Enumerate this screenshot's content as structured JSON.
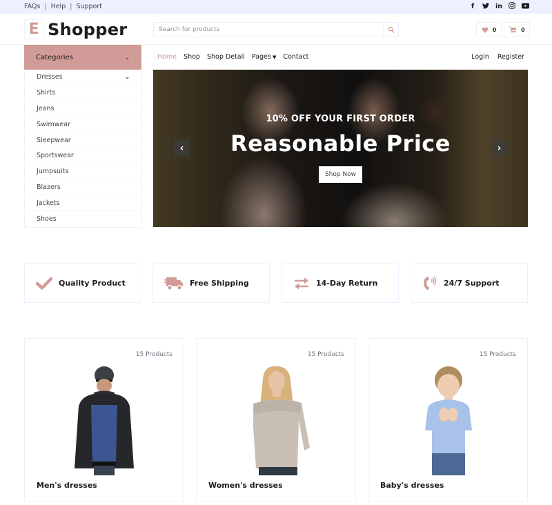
{
  "topbar": {
    "links": [
      "FAQs",
      "Help",
      "Support"
    ],
    "social_icons": [
      "facebook-icon",
      "twitter-icon",
      "linkedin-icon",
      "instagram-icon",
      "youtube-icon"
    ]
  },
  "header": {
    "logo_letter": "E",
    "logo_text": "Shopper",
    "search_placeholder": "Search for products",
    "wishlist_count": "0",
    "cart_count": "0"
  },
  "categories": {
    "title": "Categories",
    "items": [
      {
        "label": "Dresses",
        "has_submenu": true
      },
      {
        "label": "Shirts"
      },
      {
        "label": "Jeans"
      },
      {
        "label": "Swimwear"
      },
      {
        "label": "Sleepwear"
      },
      {
        "label": "Sportswear"
      },
      {
        "label": "Jumpsuits"
      },
      {
        "label": "Blazers"
      },
      {
        "label": "Jackets"
      },
      {
        "label": "Shoes"
      }
    ]
  },
  "nav": {
    "items": [
      "Home",
      "Shop",
      "Shop Detail",
      "Pages",
      "Contact"
    ],
    "active": "Home",
    "right": [
      "Login",
      "Register"
    ]
  },
  "hero": {
    "kicker": "10% OFF YOUR FIRST ORDER",
    "title": "Reasonable Price",
    "cta": "Shop Now"
  },
  "features": [
    {
      "icon": "check-icon",
      "label": "Quality Product"
    },
    {
      "icon": "shipping-truck-icon",
      "label": "Free Shipping"
    },
    {
      "icon": "exchange-arrows-icon",
      "label": "14-Day Return"
    },
    {
      "icon": "phone-volume-icon",
      "label": "24/7 Support"
    }
  ],
  "category_cards": [
    {
      "count": "15 Products",
      "name": "Men's dresses"
    },
    {
      "count": "15 Products",
      "name": "Women's dresses"
    },
    {
      "count": "15 Products",
      "name": "Baby's dresses"
    }
  ],
  "colors": {
    "accent": "#d19c97",
    "topbar_bg": "#edf1ff",
    "text_dark": "#1c1c1c",
    "text_body": "#3d464d"
  }
}
